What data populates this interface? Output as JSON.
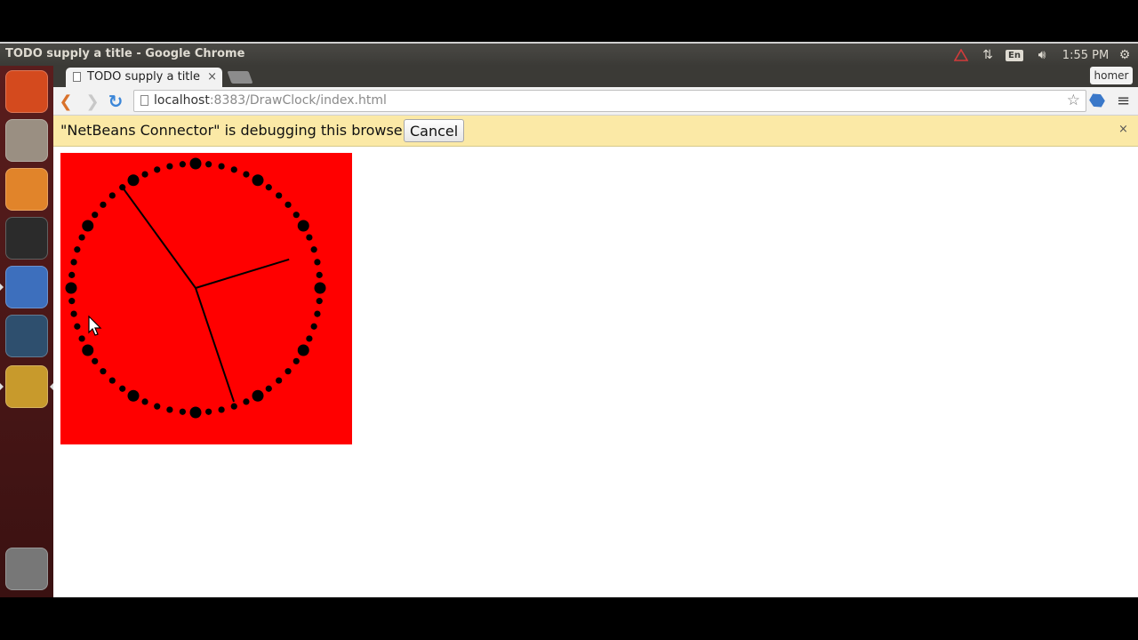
{
  "desktop": {
    "window_title": "TODO supply a title - Google Chrome",
    "tray": {
      "keyboard_layout": "En",
      "clock": "1:55 PM"
    },
    "launcher_items": [
      {
        "name": "dash-home",
        "color": "#d44a1e"
      },
      {
        "name": "files",
        "color": "#9a8f82"
      },
      {
        "name": "firefox",
        "color": "#e1842a"
      },
      {
        "name": "terminal",
        "color": "#2b2b2b"
      },
      {
        "name": "netbeans",
        "color": "#3d6fbd"
      },
      {
        "name": "mysql-workbench",
        "color": "#2e4f6e"
      },
      {
        "name": "chrome",
        "color": "#c89a2c"
      },
      {
        "name": "trash",
        "color": "#777777"
      }
    ]
  },
  "browser": {
    "tab_title": "TODO supply a title",
    "tab_close": "×",
    "user": "homer",
    "url_host": "localhost",
    "url_rest": ":8383/DrawClock/index.html",
    "infobar": {
      "message": "\"NetBeans Connector\" is debugging this browser.",
      "cancel_label": "Cancel",
      "close": "×"
    }
  },
  "clock": {
    "background_color": "#ff0000",
    "hand_color": "#000000",
    "time": {
      "hour": 2,
      "minute": 26,
      "second": 54
    }
  }
}
